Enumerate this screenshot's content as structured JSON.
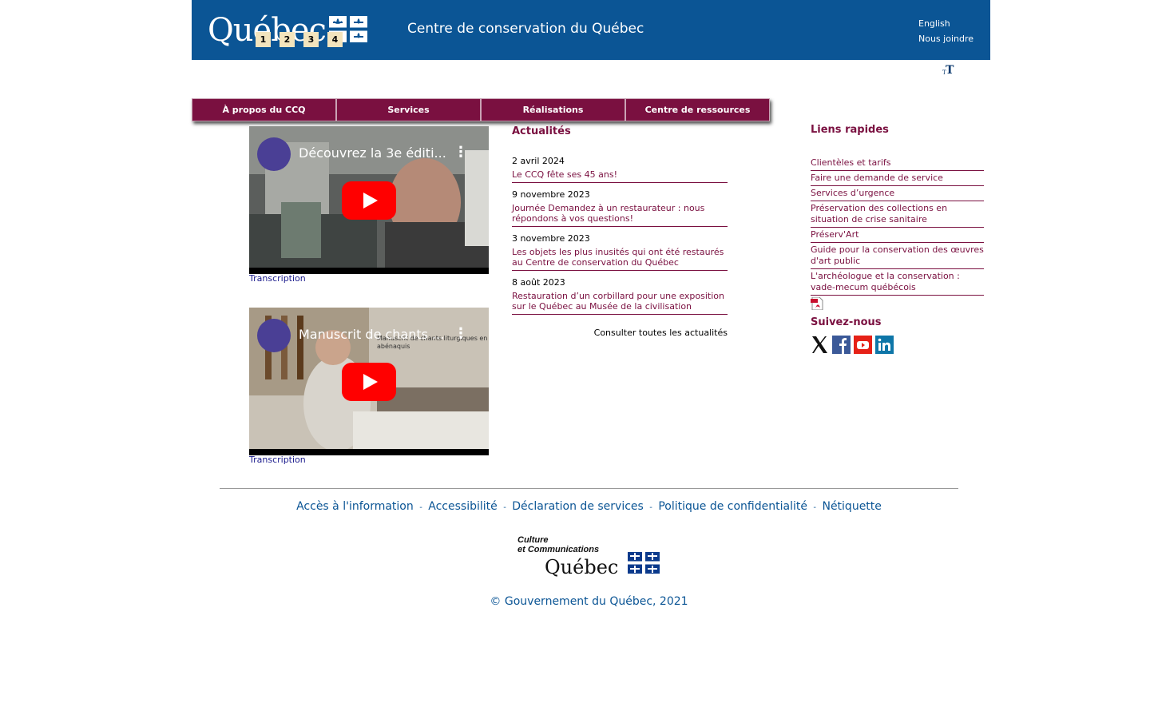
{
  "header": {
    "logo_text": "Québec",
    "access_keys": [
      "1",
      "2",
      "3",
      "4"
    ],
    "site_title": "Centre de conservation du Québec",
    "links": [
      "English",
      "Nous joindre"
    ]
  },
  "nav": {
    "items": [
      "À propos du CCQ",
      "Services",
      "Réalisations",
      "Centre de ressources"
    ]
  },
  "videos": [
    {
      "title": "Découvrez la 3e éditi...",
      "transcript_label": "Transcription"
    },
    {
      "title": "Manuscrit de chants ...",
      "overlay": "Manuscrit de chants liturgiques en abénaquis",
      "transcript_label": "Transcription"
    }
  ],
  "news": {
    "heading": "Actualités",
    "items": [
      {
        "date": "2 avril 2024",
        "title": "Le CCQ fête ses 45 ans!"
      },
      {
        "date": "9 novembre 2023",
        "title": "Journée Demandez à un restaurateur : nous répondons à vos questions!"
      },
      {
        "date": "3 novembre 2023",
        "title": "Les objets les plus inusités qui ont été restaurés au Centre de conservation du Québec"
      },
      {
        "date": "8 août 2023",
        "title": "Restauration d’un corbillard pour une exposition sur le Québec au Musée de la civilisation"
      }
    ],
    "all_link": "Consulter toutes les actualités"
  },
  "quick_links": {
    "heading": "Liens rapides",
    "items": [
      "Clientèles et tarifs",
      "Faire une demande de service",
      "Services d’urgence",
      "Préservation des collections en situation de crise sanitaire",
      "Préserv'Art",
      "Guide pour la conservation des œuvres d'art public",
      "L'archéologue et la conservation : vade-mecum québécois"
    ],
    "follow_heading": "Suivez-nous",
    "social": [
      "x-icon",
      "facebook-icon",
      "youtube-icon",
      "linkedin-icon"
    ]
  },
  "footer": {
    "links": [
      "Accès à l'information",
      "Accessibilité",
      "Déclaration de services",
      "Politique de confidentialité",
      "Nétiquette"
    ],
    "separator": "-",
    "logo_lines": [
      "Culture",
      "et Communications",
      "Québec"
    ],
    "copyright": "© Gouvernement du Québec, 2021"
  },
  "colors": {
    "header_blue": "#0b5595",
    "accent_burgundy": "#7a1040",
    "access_key_bg": "#f3e4bd"
  }
}
